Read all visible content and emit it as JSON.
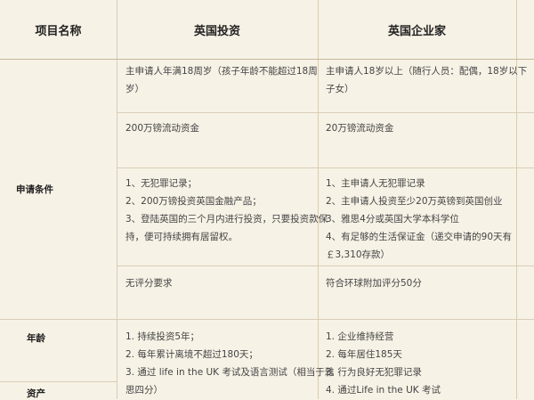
{
  "header": {
    "col1": "项目名称",
    "col2": "英国投资",
    "col3": "英国企业家"
  },
  "row_labels": {
    "conditions": "申请条件",
    "age": "年龄",
    "assets": "资产"
  },
  "rows": [
    {
      "investor": [
        "主申请人年满18周岁（孩子年龄不能超过18周",
        "岁）"
      ],
      "entrepreneur": [
        "主申请人18岁以上（随行人员：配偶，18岁以下",
        "子女）"
      ]
    },
    {
      "investor": [
        "200万镑流动资金"
      ],
      "entrepreneur": [
        "20万镑流动资金"
      ]
    },
    {
      "investor": [
        "1、无犯罪记录；",
        "2、200万镑投资英国金融产品；",
        "3、登陆英国的三个月内进行投资，只要投资款保",
        "持，便可持续拥有居留权。"
      ],
      "entrepreneur": [
        "1、主申请人无犯罪记录",
        "2、主申请人投资至少20万英镑到英国创业",
        "3、雅思4分或英国大学本科学位",
        "4、有足够的生活保证金（递交申请的90天有",
        "￡3,310存款）"
      ]
    },
    {
      "investor": [
        "无评分要求"
      ],
      "entrepreneur": [
        "符合环球附加评分50分"
      ]
    },
    {
      "investor": [
        "1. 持续投资5年；",
        "2. 每年累计离境不超过180天；",
        "3. 通过 life in the UK 考试及语言测试（相当于雅",
        "思四分）"
      ],
      "entrepreneur": [
        "1. 企业维持经营",
        "2. 每年居住185天",
        "3. 行为良好无犯罪记录",
        "4. 通过Life in the UK 考试"
      ]
    }
  ]
}
